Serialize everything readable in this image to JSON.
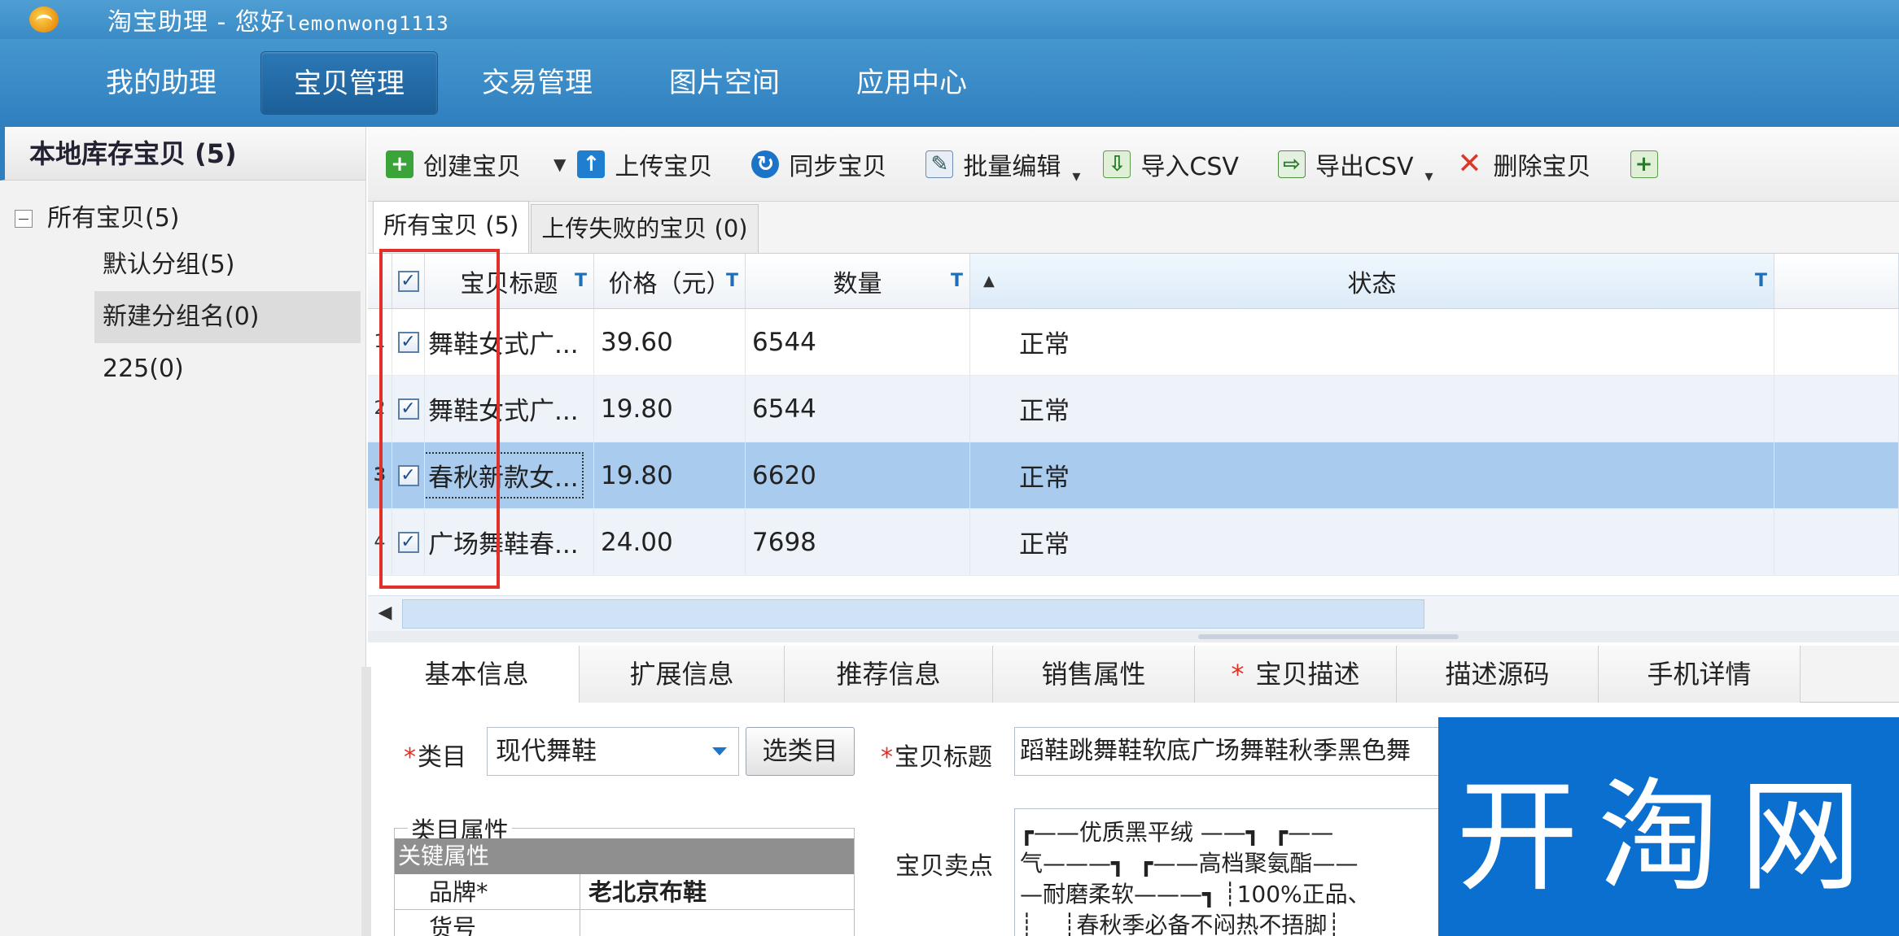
{
  "app": {
    "title_prefix": "淘宝助理 - 您好",
    "username": "lemonwong1113"
  },
  "mainnav": [
    {
      "label": "我的助理"
    },
    {
      "label": "宝贝管理"
    },
    {
      "label": "交易管理"
    },
    {
      "label": "图片空间"
    },
    {
      "label": "应用中心"
    }
  ],
  "sidebar": {
    "header": "本地库存宝贝 (5)",
    "root": "所有宝贝(5)",
    "items": [
      {
        "label": "默认分组(5)"
      },
      {
        "label": "新建分组名(0)"
      },
      {
        "label": "225(0)"
      }
    ]
  },
  "toolbar": {
    "create": "创建宝贝",
    "upload": "上传宝贝",
    "sync": "同步宝贝",
    "batch_edit": "批量编辑",
    "import_csv": "导入CSV",
    "export_csv": "导出CSV",
    "delete": "删除宝贝"
  },
  "grid_tabs": [
    {
      "label": "所有宝贝 (5)"
    },
    {
      "label": "上传失败的宝贝 (0)"
    }
  ],
  "grid": {
    "columns": {
      "title": "宝贝标题",
      "price": "价格（元）",
      "qty": "数量",
      "status": "状态"
    },
    "rows": [
      {
        "num": "1",
        "title": "舞鞋女式广...",
        "price": "39.60",
        "qty": "6544",
        "status": "正常"
      },
      {
        "num": "2",
        "title": "舞鞋女式广...",
        "price": "19.80",
        "qty": "6544",
        "status": "正常"
      },
      {
        "num": "3",
        "title": "春秋新款女...",
        "price": "19.80",
        "qty": "6620",
        "status": "正常"
      },
      {
        "num": "4",
        "title": "广场舞鞋春...",
        "price": "24.00",
        "qty": "7698",
        "status": "正常"
      }
    ]
  },
  "detail_tabs": [
    {
      "label": "基本信息"
    },
    {
      "label": "扩展信息"
    },
    {
      "label": "推荐信息"
    },
    {
      "label": "销售属性"
    },
    {
      "label": "宝贝描述",
      "required": true
    },
    {
      "label": "描述源码"
    },
    {
      "label": "手机详情"
    }
  ],
  "form": {
    "category_label": "类目",
    "category_value": "现代舞鞋",
    "pick_category": "选类目",
    "title_label": "宝贝标题",
    "title_value": "蹈鞋跳舞鞋软底广场舞鞋秋季黑色舞",
    "attr_group": "类目属性",
    "key_attrs": "关键属性",
    "brand_key": "品牌*",
    "brand_value": "老北京布鞋",
    "next_key": "货号",
    "selling_label": "宝贝卖点",
    "selling_text": "┏——优质黑平绒 ——┓  ┏——\n气———┓  ┏——高档聚氨酯——\n—耐磨柔软———┓ ┊100%正品、\n┊    ┊春秋季必备不闷热不捂脚┊"
  },
  "watermark": "开淘网"
}
